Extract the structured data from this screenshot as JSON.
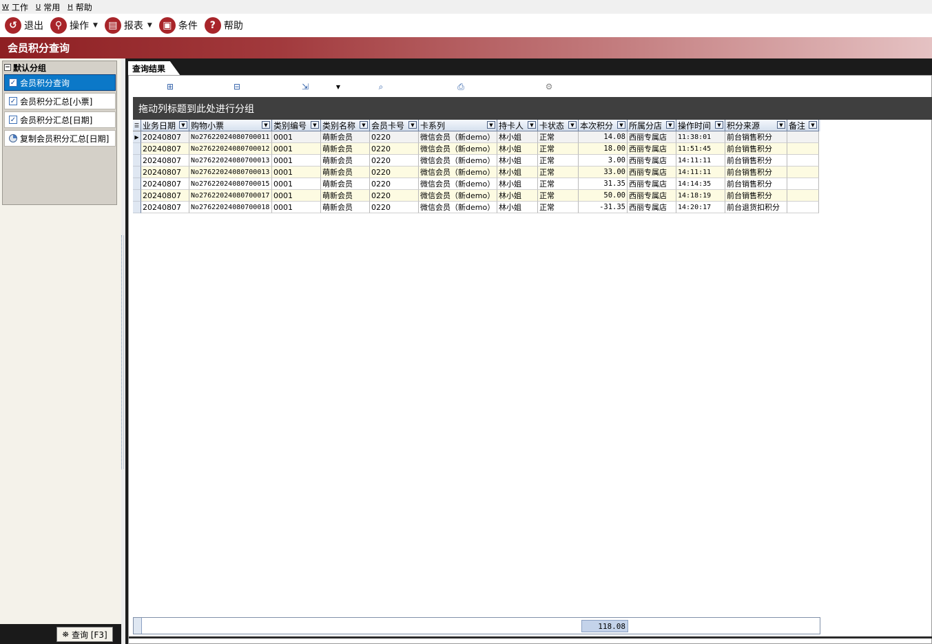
{
  "menu": [
    {
      "key": "W",
      "label": "工作"
    },
    {
      "key": "U",
      "label": "常用"
    },
    {
      "key": "H",
      "label": "帮助"
    }
  ],
  "toolbar": {
    "exit": "退出",
    "operate": "操作",
    "report": "报表",
    "condition": "条件",
    "help": "帮助"
  },
  "title": "会员积分查询",
  "groups": {
    "header": "默认分组",
    "items": [
      "会员积分查询",
      "会员积分汇总[小票]",
      "会员积分汇总[日期]",
      "复制会员积分汇总[日期]"
    ]
  },
  "query_button": "查询 [F3]",
  "tab_label": "查询结果",
  "group_hint": "拖动列标题到此处进行分组",
  "columns": [
    "业务日期",
    "购物小票",
    "类别编号",
    "类别名称",
    "会员卡号",
    "卡系列",
    "持卡人",
    "卡状态",
    "本次积分",
    "所属分店",
    "操作时间",
    "积分来源",
    "备注"
  ],
  "rows": [
    [
      "20240807",
      "No27622024080700011",
      "0001",
      "萌新会员",
      "0220",
      "微信会员（新demo）",
      "林小姐",
      "正常",
      "14.08",
      "西丽专属店",
      "11:38:01",
      "前台销售积分",
      ""
    ],
    [
      "20240807",
      "No27622024080700012",
      "0001",
      "萌新会员",
      "0220",
      "微信会员（新demo）",
      "林小姐",
      "正常",
      "18.00",
      "西丽专属店",
      "11:51:45",
      "前台销售积分",
      ""
    ],
    [
      "20240807",
      "No27622024080700013",
      "0001",
      "萌新会员",
      "0220",
      "微信会员（新demo）",
      "林小姐",
      "正常",
      "3.00",
      "西丽专属店",
      "14:11:11",
      "前台销售积分",
      ""
    ],
    [
      "20240807",
      "No27622024080700013",
      "0001",
      "萌新会员",
      "0220",
      "微信会员（新demo）",
      "林小姐",
      "正常",
      "33.00",
      "西丽专属店",
      "14:11:11",
      "前台销售积分",
      ""
    ],
    [
      "20240807",
      "No27622024080700015",
      "0001",
      "萌新会员",
      "0220",
      "微信会员（新demo）",
      "林小姐",
      "正常",
      "31.35",
      "西丽专属店",
      "14:14:35",
      "前台销售积分",
      ""
    ],
    [
      "20240807",
      "No27622024080700017",
      "0001",
      "萌新会员",
      "0220",
      "微信会员（新demo）",
      "林小姐",
      "正常",
      "50.00",
      "西丽专属店",
      "14:18:19",
      "前台销售积分",
      ""
    ],
    [
      "20240807",
      "No27622024080700018",
      "0001",
      "萌新会员",
      "0220",
      "微信会员（新demo）",
      "林小姐",
      "正常",
      "-31.35",
      "西丽专属店",
      "14:20:17",
      "前台退货扣积分",
      ""
    ]
  ],
  "summary_total": "118.08",
  "icons": {
    "exit": "undo-arrow-icon",
    "operate": "magnifier-icon",
    "report": "printer-icon",
    "condition": "filter-card-icon",
    "help": "question-icon"
  },
  "colors": {
    "accent": "#a8252a",
    "selection": "#0b78c8",
    "row_alt": "#fdfbe2"
  }
}
